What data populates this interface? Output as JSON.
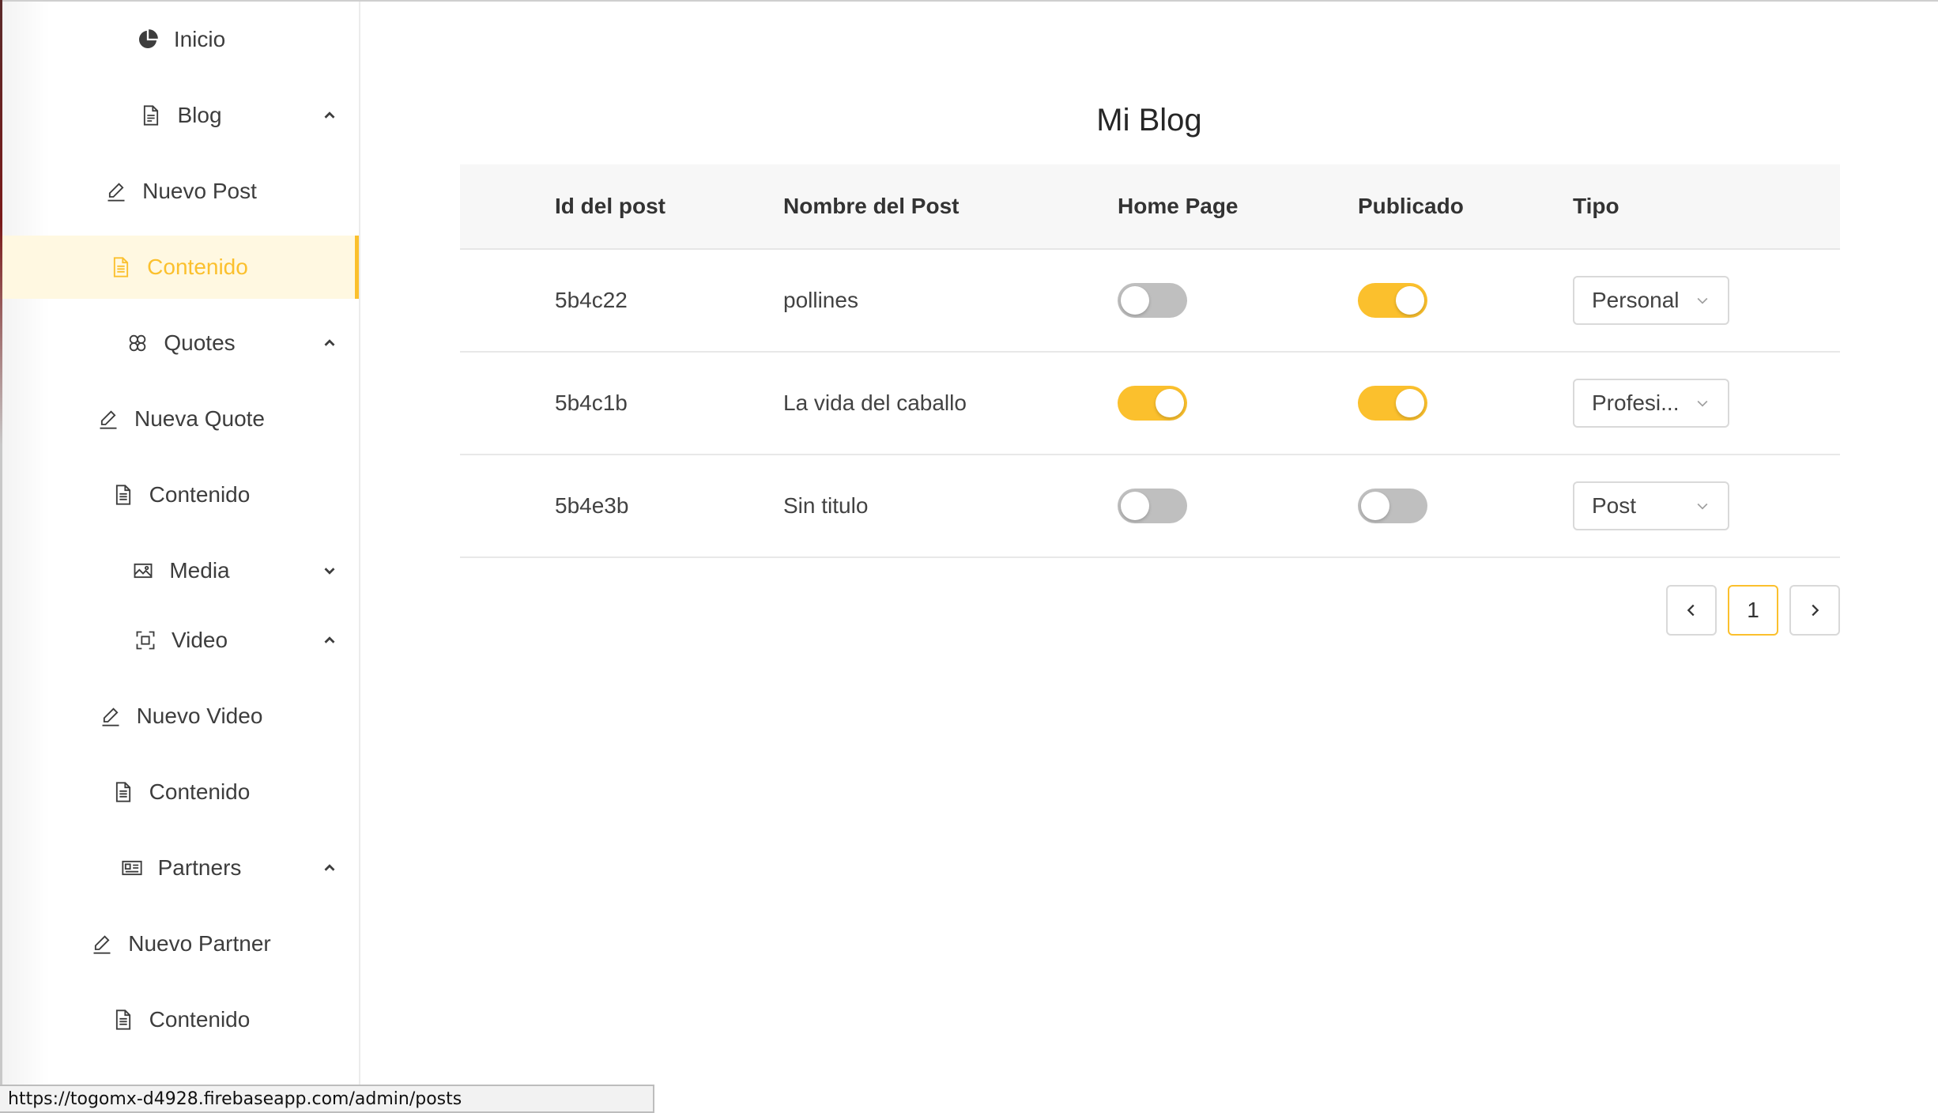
{
  "sidebar": {
    "items": [
      {
        "label": "Inicio",
        "icon": "pie-chart-icon"
      },
      {
        "label": "Blog",
        "icon": "file-icon",
        "chevron": "up"
      },
      {
        "label": "Nuevo Post",
        "icon": "edit-icon"
      },
      {
        "label": "Contenido",
        "icon": "file-text-icon",
        "active": true
      },
      {
        "label": "Quotes",
        "icon": "flower-icon",
        "chevron": "up"
      },
      {
        "label": "Nueva Quote",
        "icon": "edit-icon"
      },
      {
        "label": "Contenido",
        "icon": "file-text-icon"
      },
      {
        "label": "Media",
        "icon": "picture-icon",
        "chevron": "down"
      },
      {
        "label": "Video",
        "icon": "scan-icon",
        "chevron": "up"
      },
      {
        "label": "Nuevo Video",
        "icon": "edit-icon"
      },
      {
        "label": "Contenido",
        "icon": "file-text-icon"
      },
      {
        "label": "Partners",
        "icon": "idcard-icon",
        "chevron": "up"
      },
      {
        "label": "Nuevo Partner",
        "icon": "edit-icon"
      },
      {
        "label": "Contenido",
        "icon": "file-text-icon"
      }
    ]
  },
  "main": {
    "title": "Mi Blog",
    "columns": [
      "Id del post",
      "Nombre del Post",
      "Home Page",
      "Publicado",
      "Tipo"
    ],
    "rows": [
      {
        "id": "5b4c22",
        "name": "pollines",
        "home_page": false,
        "publicado": true,
        "tipo": "Personal"
      },
      {
        "id": "5b4c1b",
        "name": "La vida del caballo",
        "home_page": true,
        "publicado": true,
        "tipo": "Profesi..."
      },
      {
        "id": "5b4e3b",
        "name": "Sin titulo",
        "home_page": false,
        "publicado": false,
        "tipo": "Post"
      }
    ],
    "pagination": {
      "current_page": "1"
    }
  },
  "statusbar": {
    "url": "https://togomx-d4928.firebaseapp.com/admin/posts"
  },
  "colors": {
    "accent": "#fbc02d",
    "active_bg": "#fff8e1",
    "toggle_off": "#bfbfbf"
  }
}
